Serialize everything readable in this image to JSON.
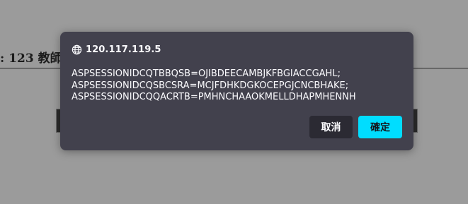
{
  "background": {
    "text": ": 123  教師"
  },
  "dialog": {
    "origin": "120.117.119.5",
    "icon": "globe-icon",
    "message": "ASPSESSIONIDCQTBBQSB=OJIBDEECAMBJKFBGIACCGAHL;\nASPSESSIONIDCQSBCSRA=MCJFDHKDGKOCEPGJCNCBHAKE;\nASPSESSIONIDCQQACRTB=PMHNCHAAOKMELLDHAPMHENNH",
    "cancel_label": "取消",
    "ok_label": "確定"
  },
  "colors": {
    "backdrop": "#9b9b9b",
    "dialog_bg": "#42414d",
    "primary_button": "#00ddff",
    "secondary_button": "#2b2a33"
  }
}
